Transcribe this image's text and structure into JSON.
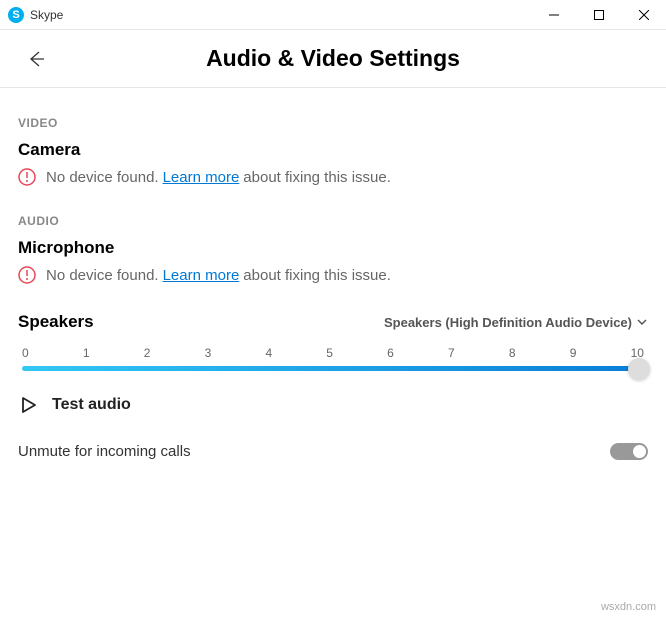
{
  "titlebar": {
    "app_name": "Skype",
    "logo_initial": "S"
  },
  "header": {
    "title": "Audio & Video Settings"
  },
  "video": {
    "section_label": "VIDEO",
    "heading": "Camera",
    "warning_prefix": "No device found.",
    "warning_link": "Learn more",
    "warning_suffix": "about fixing this issue."
  },
  "audio": {
    "section_label": "AUDIO",
    "heading": "Microphone",
    "warning_prefix": "No device found.",
    "warning_link": "Learn more",
    "warning_suffix": "about fixing this issue."
  },
  "speakers": {
    "heading": "Speakers",
    "device": "Speakers (High Definition Audio Device)",
    "ticks": [
      "0",
      "1",
      "2",
      "3",
      "4",
      "5",
      "6",
      "7",
      "8",
      "9",
      "10"
    ],
    "value": 10
  },
  "test_audio": {
    "label": "Test audio"
  },
  "unmute": {
    "label": "Unmute for incoming calls",
    "on": true
  },
  "watermark": "wsxdn.com"
}
